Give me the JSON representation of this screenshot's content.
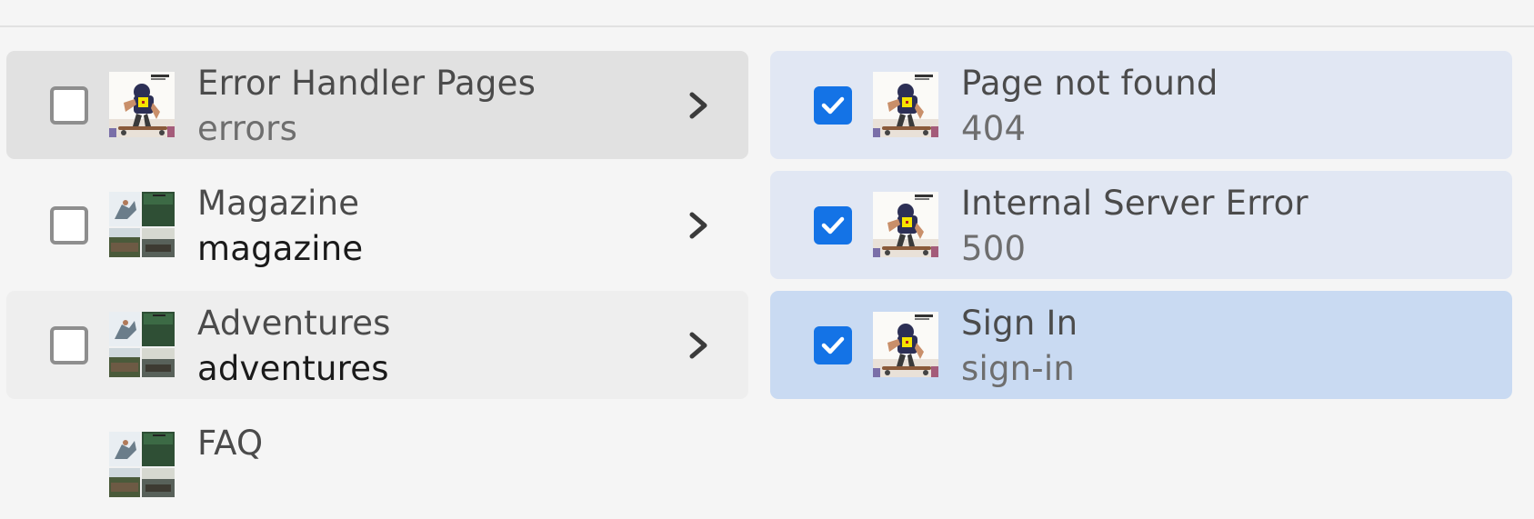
{
  "colors": {
    "accent": "#1473e6",
    "selected_left": "#e1e1e1",
    "selected_right": "#e1e7f3",
    "active_right": "#c9daf2"
  },
  "left_column": {
    "items": [
      {
        "title": "Error Handler Pages",
        "name": "errors",
        "checked": false,
        "thumbnail": "skater-thumbnail"
      },
      {
        "title": "Magazine",
        "name": "magazine",
        "checked": false,
        "thumbnail": "collage-thumbnail"
      },
      {
        "title": "Adventures",
        "name": "adventures",
        "checked": false,
        "thumbnail": "collage-thumbnail"
      },
      {
        "title": "FAQ",
        "name": "",
        "checked": false,
        "thumbnail": "collage-thumbnail"
      }
    ]
  },
  "right_column": {
    "items": [
      {
        "title": "Page not found",
        "name": "404",
        "checked": true,
        "thumbnail": "skater-thumbnail"
      },
      {
        "title": "Internal Server Error",
        "name": "500",
        "checked": true,
        "thumbnail": "skater-thumbnail"
      },
      {
        "title": "Sign In",
        "name": "sign-in",
        "checked": true,
        "thumbnail": "skater-thumbnail"
      }
    ]
  },
  "icons": {
    "checkbox_checked": "checkmark-icon",
    "navigate": "chevron-right-icon"
  }
}
